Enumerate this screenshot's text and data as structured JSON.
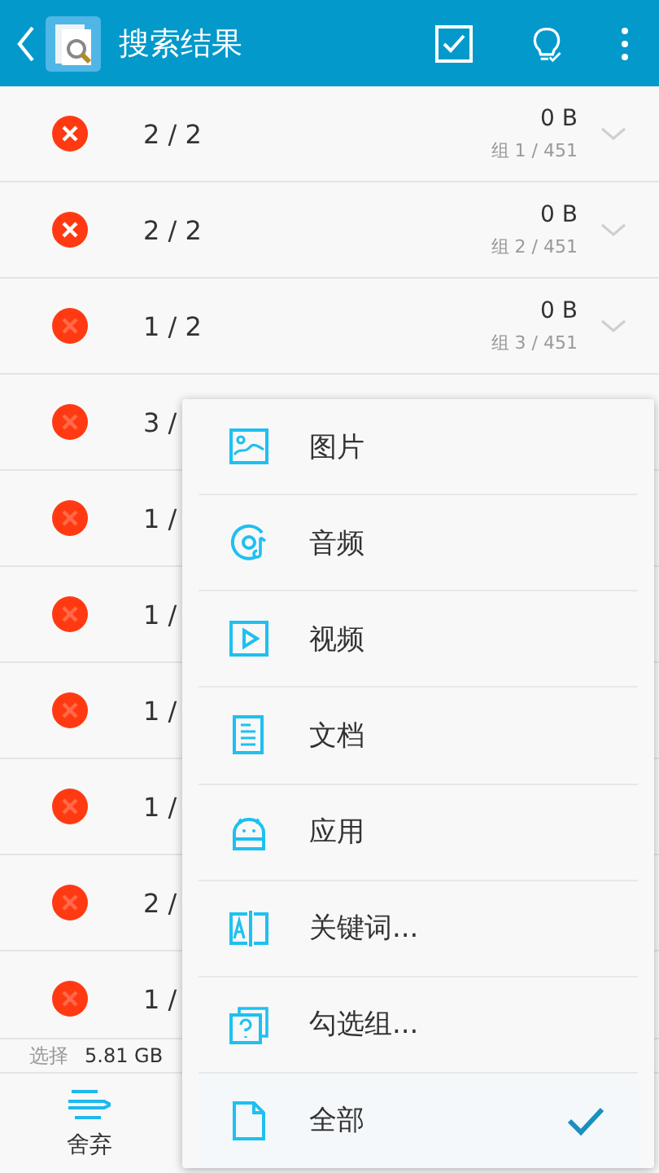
{
  "app_bar": {
    "title": "搜索结果"
  },
  "groups": [
    {
      "marked": true,
      "count": "2 / 2",
      "size": "0 B",
      "group": "组 1 / 451"
    },
    {
      "marked": true,
      "count": "2 / 2",
      "size": "0 B",
      "group": "组 2 / 451"
    },
    {
      "marked": false,
      "count": "1 / 2",
      "size": "0 B",
      "group": "组 3 / 451"
    },
    {
      "marked": false,
      "count": "3 /"
    },
    {
      "marked": false,
      "count": "1 /"
    },
    {
      "marked": false,
      "count": "1 /"
    },
    {
      "marked": false,
      "count": "1 /"
    },
    {
      "marked": false,
      "count": "1 /"
    },
    {
      "marked": false,
      "count": "2 /"
    },
    {
      "marked": false,
      "count": "1 /"
    }
  ],
  "selection": {
    "label": "选择",
    "size": "5.81 GB"
  },
  "toolbar": [
    {
      "label": "舍弃"
    }
  ],
  "filter_menu": [
    {
      "kind": "image",
      "label": "图片",
      "selected": false
    },
    {
      "kind": "audio",
      "label": "音频",
      "selected": false
    },
    {
      "kind": "video",
      "label": "视频",
      "selected": false
    },
    {
      "kind": "document",
      "label": "文档",
      "selected": false
    },
    {
      "kind": "app",
      "label": "应用",
      "selected": false
    },
    {
      "kind": "keyword",
      "label": "关键词...",
      "selected": false
    },
    {
      "kind": "group",
      "label": "勾选组...",
      "selected": false
    },
    {
      "kind": "all",
      "label": "全部",
      "selected": true
    }
  ]
}
